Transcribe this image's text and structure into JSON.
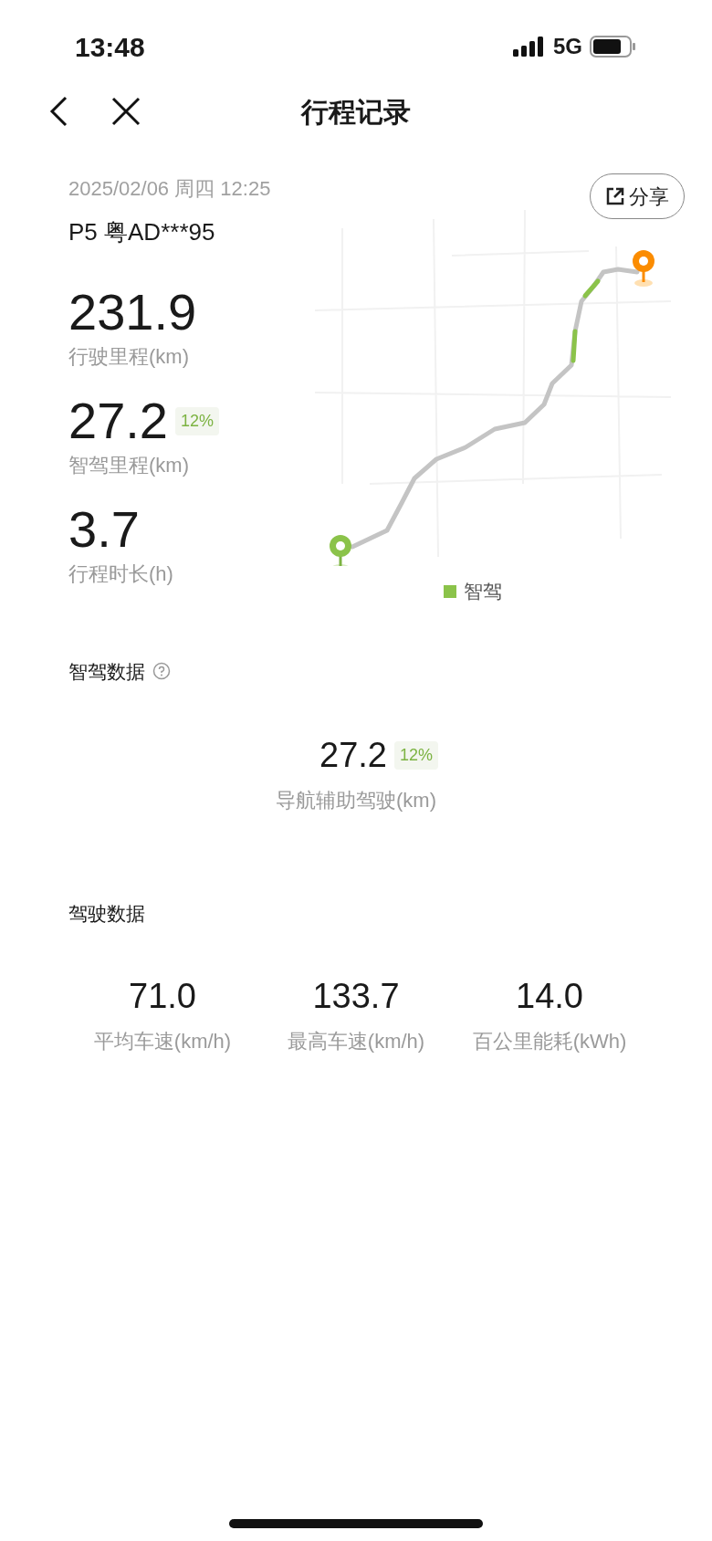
{
  "status_bar": {
    "time": "13:48",
    "network": "5G"
  },
  "nav": {
    "title": "行程记录"
  },
  "trip": {
    "datetime": "2025/02/06 周四 12:25",
    "vehicle": "P5 粤AD***95",
    "share": "分享"
  },
  "stats": [
    {
      "value": "231.9",
      "label": "行驶里程(km)"
    },
    {
      "value": "27.2",
      "badge": "12%",
      "label": "智驾里程(km)"
    },
    {
      "value": "3.7",
      "label": "行程时长(h)"
    }
  ],
  "map": {
    "legend": [
      {
        "label": "智驾",
        "color": "#8bc34a"
      }
    ]
  },
  "smart_driving": {
    "title": "智驾数据",
    "value": "27.2",
    "badge": "12%",
    "label": "导航辅助驾驶(km)"
  },
  "driving": {
    "title": "驾驶数据",
    "stats": [
      {
        "value": "71.0",
        "label": "平均车速(km/h)"
      },
      {
        "value": "133.7",
        "label": "最高车速(km/h)"
      },
      {
        "value": "14.0",
        "label": "百公里能耗(kWh)"
      }
    ]
  }
}
